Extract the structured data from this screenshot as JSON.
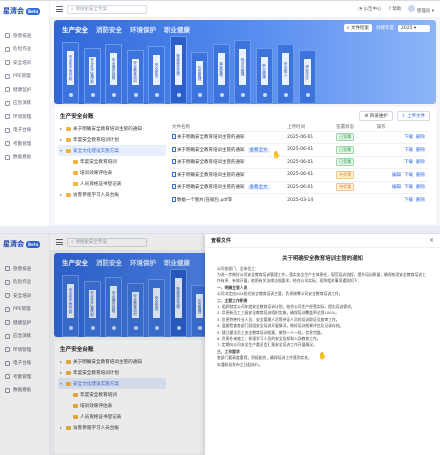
{
  "app": {
    "name": "星清会",
    "badge": "Beta"
  },
  "sidebar": {
    "items": [
      "隐患排查",
      "危险作业",
      "安全培训",
      "PPE管理",
      "健康监护",
      "应急演练",
      "环境管理",
      "电子台账",
      "考勤管理",
      "数据看板"
    ]
  },
  "topbar": {
    "search_placeholder": "请搜索安全专案",
    "notice": "公告中心",
    "help": "帮助",
    "user": "管理员"
  },
  "banner": {
    "tabs": [
      "生产安全",
      "消防安全",
      "环境保护",
      "职业健康"
    ],
    "filter_btn": "文件检索",
    "year_label": "创建年度",
    "year_value": "2025",
    "binders": [
      "安全生产责任制",
      "安全生产管理制度",
      "安全操作规程",
      "安全教育培训",
      "安全检查",
      "隐患排查治理",
      "应急管理",
      "事故管理",
      "相关方管理",
      "职业健康",
      "安全投入",
      "绩效评定"
    ]
  },
  "panel": {
    "title": "生产安全台账",
    "btn_new": "目录维护",
    "btn_upload": "上传文件",
    "tree": [
      {
        "label": "关于明确安全教育培训主管的通知",
        "level": 0
      },
      {
        "label": "年度安全教育培训计划",
        "level": 0
      },
      {
        "label": "安全文化建设实施方案",
        "level": 0,
        "selected": true
      },
      {
        "label": "年度安全教育培训",
        "level": 1
      },
      {
        "label": "培训效果评估表",
        "level": 1
      },
      {
        "label": "人员资格证书登记表",
        "level": 1
      },
      {
        "label": "访客参观学习人员台账",
        "level": 0
      }
    ],
    "columns": [
      "文件名称",
      "上传时间",
      "签署状态",
      "操作"
    ],
    "rows": [
      {
        "name": "关于明确安全教育培训主管的通知",
        "time": "2025-06-01",
        "status": "已签署",
        "kind": "ok",
        "ops": [
          "下载",
          "删除"
        ]
      },
      {
        "name": "关于明确安全教育培训主管的通知",
        "time": "2025-06-01",
        "status": "已签署",
        "kind": "ok",
        "ops": [
          "下载",
          "删除"
        ],
        "tag": "查看全文"
      },
      {
        "name": "关于明确安全教育培训主管的通知",
        "time": "2025-06-01",
        "status": "已签署",
        "kind": "ok",
        "ops": [
          "下载",
          "删除"
        ]
      },
      {
        "name": "关于明确安全教育培训主管的通知",
        "time": "2025-06-01",
        "status": "待签署",
        "kind": "wait",
        "ops": [
          "编辑",
          "下载",
          "删除"
        ]
      },
      {
        "name": "关于明确安全教育培训主管的通知",
        "time": "2025-06-01",
        "status": "待签署",
        "kind": "wait",
        "ops": [
          "编辑",
          "下载",
          "删除"
        ],
        "tag": "查看全文"
      },
      {
        "name": "数据一个图片/压缩包.pdf等",
        "time": "2025-03-14",
        "status": "",
        "kind": "",
        "ops": [
          "下载",
          "删除"
        ]
      }
    ]
  },
  "drawer": {
    "header": "查看文件",
    "close": "×",
    "title": "关于明确安全教育培训主管的通知",
    "body": [
      "公司各部门、全体员工：",
      "为进一步做好公司安全教育培训管理工作，落实安全生产主体责任，规范培训流程，提升培训质量，确保各项安全教育培训工作有序、有效开展，依照有关法律法规要求，结合公司实际，现将相关事项通知如下：",
      "一、明确主管人员",
      "公司决定由XXX担任安全教育培训主管，负责统筹公司安全教育培训工作。",
      "二、主要工作职责",
      "1. 组织制定公司年度安全教育培训计划，结合公司生产经营实际，提出培训需求。",
      "2. 负责新员工三级安全教育培训组织实施，确保培训覆盖率达到100%。",
      "3. 负责特种作业人员、安全管理人员等持证人员的培训取证及复审工作。",
      "4. 监督检查各部门班组安全培训开展情况，做好培训效果评估及记录存档。",
      "5. 建立健全员工安全教育培训档案，做到一人一档，信息完整。",
      "6. 负责外来施工、参观学习人员的安全告知和入场教育工作。",
      "7. 定期向公司安全生产委员会汇报安全培训工作开展情况。",
      "三、工作要求",
      "各部门要高度重视，积极配合，确保培训工作落到实处。",
      "本通知自发布之日起执行。"
    ]
  }
}
